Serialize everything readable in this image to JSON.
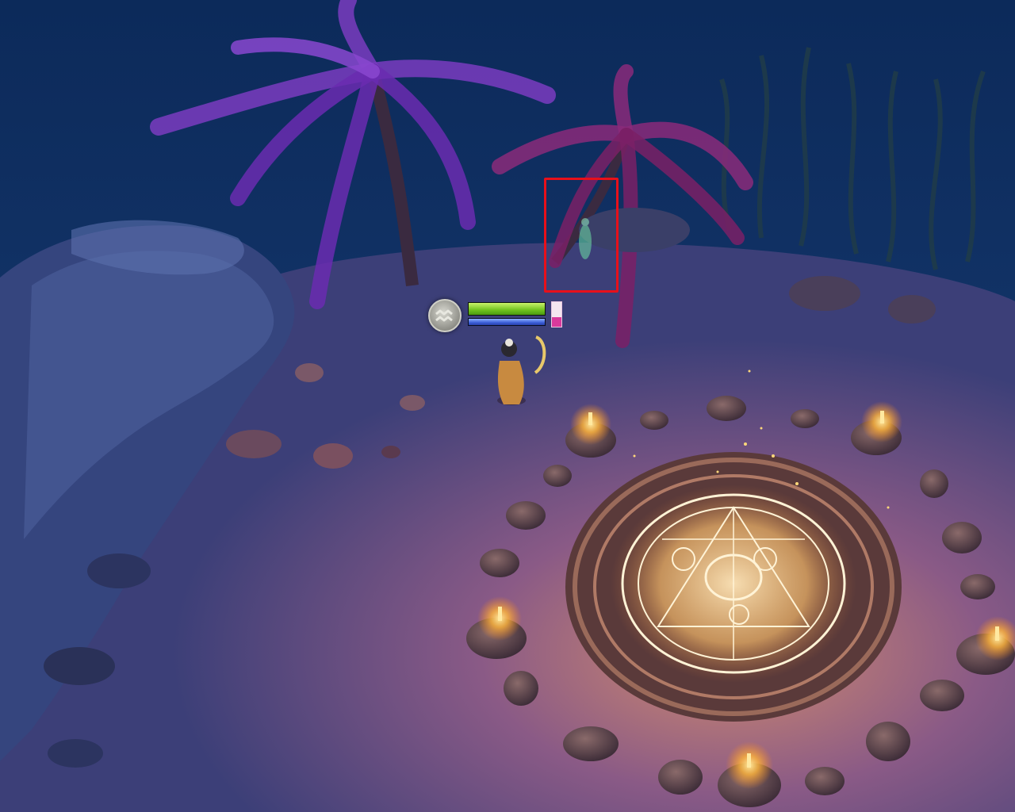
{
  "game": {
    "player": {
      "zodiac_icon": "aquarius-icon",
      "health_fraction": 1.0,
      "mana_fraction": 1.0,
      "stamina_fraction": 0.4
    },
    "target_marker": {
      "type": "highlight-box",
      "color": "#e8101a"
    },
    "colors": {
      "health": "#6fc21e",
      "mana": "#3b5fd8",
      "stamina": "#d8399c",
      "candle_glow": "#ffb43a",
      "rune_circle": "#fff3d6"
    }
  }
}
